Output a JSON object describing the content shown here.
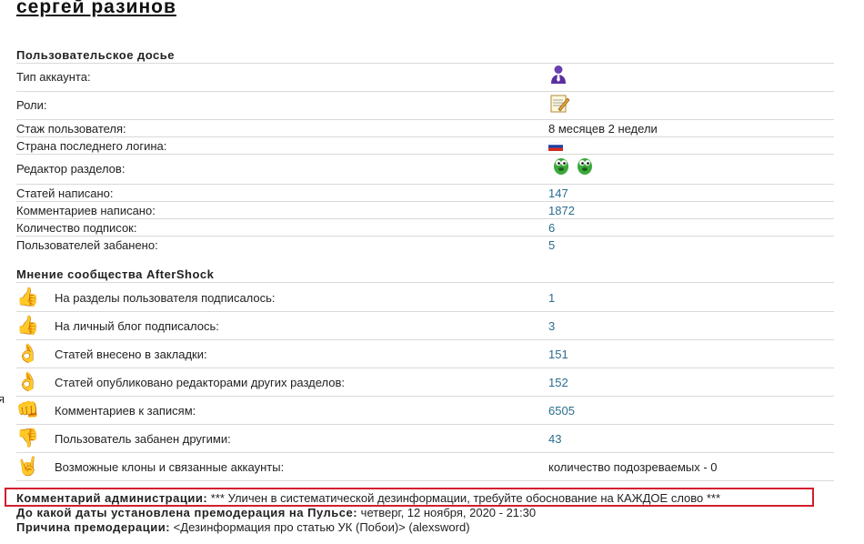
{
  "user": {
    "name": "сергей разинов"
  },
  "dossier": {
    "title": "Пользовательское досье",
    "rows": [
      {
        "label": "Тип аккаунта:",
        "icon": "user-tie-icon"
      },
      {
        "label": "Роли:",
        "icon": "notepad-pencil-icon"
      },
      {
        "label": "Стаж пользователя:",
        "value": "8 месяцев 2 недели"
      },
      {
        "label": "Страна последнего логина:",
        "icon": "russia-flag-icon"
      },
      {
        "label": "Редактор разделов:",
        "icon": "green-monster-icon"
      },
      {
        "label": "Статей написано:",
        "value": "147"
      },
      {
        "label": "Комментариев написано:",
        "value": "1872"
      },
      {
        "label": "Количество подписок:",
        "value": "6"
      },
      {
        "label": "Пользователей забанено:",
        "value": "5"
      }
    ]
  },
  "opinion": {
    "title": "Мнение сообщества AfterShock",
    "rows": [
      {
        "icon": "thumbs-up-icon",
        "label": "На разделы пользователя подписалось:",
        "value": "1"
      },
      {
        "icon": "thumbs-up-icon",
        "label": "На личный блог подписалось:",
        "value": "3"
      },
      {
        "icon": "ok-hand-icon",
        "label": "Статей внесено в закладки:",
        "value": "151"
      },
      {
        "icon": "ok-hand-icon",
        "label": "Статей опубликовано редакторами других разделов:",
        "value": "152"
      },
      {
        "icon": "fist-icon",
        "label": "Комментариев к записям:",
        "value": "6505"
      },
      {
        "icon": "thumbs-down-icon",
        "label": "Пользователь забанен другими:",
        "value": "43"
      },
      {
        "icon": "horns-hand-icon",
        "label": "Возможные клоны и связанные аккаунты:",
        "value": "количество подозреваемых - 0"
      }
    ]
  },
  "admin": {
    "comment_label": "Комментарий администрации:",
    "comment_text": "*** Уличен в систематической дезинформации, требуйте обоснование на КАЖДОЕ слово ***",
    "premod_date_label": "До какой даты установлена премодерация на Пульсе:",
    "premod_date_value": "четверг, 12 ноября, 2020 - 21:30",
    "premod_reason_label": "Причина премодерации:",
    "premod_reason_value": "<Дезинформация про статью УК (Побои)> (alexsword)"
  },
  "edge_char": "я",
  "colors": {
    "link": "#2a6d8f",
    "highlight_border": "#d21e2d"
  }
}
